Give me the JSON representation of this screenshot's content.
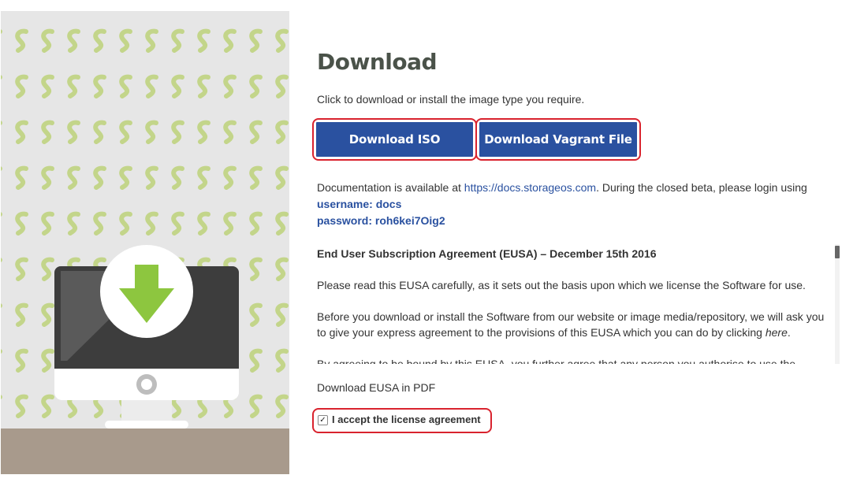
{
  "page": {
    "title": "Download",
    "intro": "Click to download or install the image type you require."
  },
  "buttons": {
    "iso": "Download ISO",
    "vagrant": "Download Vagrant File"
  },
  "docs": {
    "prefix": "Documentation is available at ",
    "link": "https://docs.storageos.com",
    "suffix": ". During the closed beta, please login using",
    "username": "username: docs",
    "password": "password: roh6kei7Oig2"
  },
  "eusa": {
    "heading": "End User Subscription Agreement (EUSA) – December 15th 2016",
    "p1": "Please read this EUSA carefully, as it sets out the basis upon which we license the Software for use.",
    "p2_line1": "Before you download or install the Software from our website or image media/repository, we will ask you",
    "p2_line2a": "to give your express agreement to the provisions of this EUSA which you can do by clicking ",
    "p2_here": "here",
    "p2_end": ".",
    "p3": "By agreeing to be bound by this EUSA, you further agree that any person you authorise to use the"
  },
  "pdf_link": "Download EUSA in PDF",
  "accept": {
    "label": "I accept the license agreement",
    "checked": true,
    "checkmark": "✓"
  },
  "colors": {
    "primary_button": "#2a51a0",
    "highlight_border": "#d9232e",
    "pattern_green": "#c3d58a",
    "arrow_green": "#8dc63f"
  },
  "icons": {
    "illustration": "monitor-download-icon",
    "checkbox": "checkbox-checked-icon"
  }
}
